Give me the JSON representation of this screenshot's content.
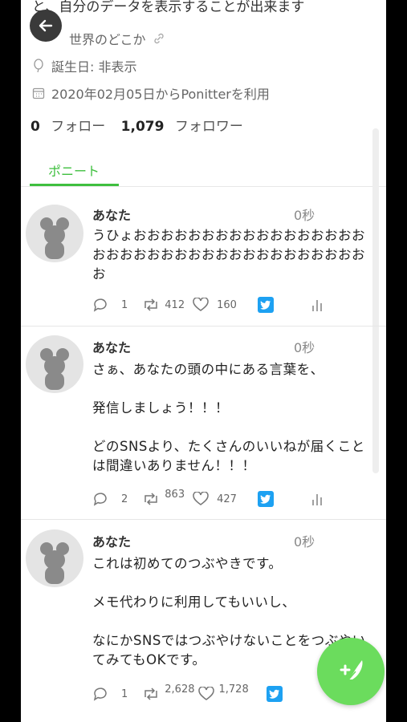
{
  "profile": {
    "bio_tail": "と、自分のデータを表示することが出来ます",
    "location": "世界のどこか",
    "birthday": "誕生日: 非表示",
    "joined": "2020年02月05日からPonitterを利用",
    "following_count": "0",
    "following_label": "フォロー",
    "followers_count": "1,079",
    "followers_label": "フォロワー"
  },
  "tabs": [
    {
      "label": "ポニート",
      "active": true
    }
  ],
  "posts": [
    {
      "name": "あなた",
      "time": "0秒",
      "text": "うひょおおおおおおおおおおおおおおおおおおおおおおおおおおおおおおおおおおおおおお",
      "replies": "1",
      "retweets": "412",
      "likes": "160"
    },
    {
      "name": "あなた",
      "time": "0秒",
      "text": "さぁ、あなたの頭の中にある言葉を、\n\n発信しましょう！！！\n\nどのSNSより、たくさんのいいねが届くことは間違いありません！！！",
      "replies": "2",
      "retweets": "863",
      "likes": "427"
    },
    {
      "name": "あなた",
      "time": "0秒",
      "text": "これは初めてのつぶやきです。\n\nメモ代わりに利用してもいいし、\n\nなにかSNSではつぶやけないことをつぶやいてみてもOKです。",
      "replies": "1",
      "retweets": "2,628",
      "likes": "1,728"
    }
  ],
  "icons": {
    "back": "arrow-left-icon",
    "location": "location-pin-icon",
    "link": "link-icon",
    "birthday": "balloon-icon",
    "calendar": "calendar-icon",
    "reply": "reply-icon",
    "retweet": "retweet-icon",
    "like": "heart-icon",
    "share": "twitter-icon",
    "stats": "bar-chart-icon",
    "compose": "compose-feather-icon"
  },
  "colors": {
    "accent": "#3fbf3f",
    "fab": "#6bdc5d",
    "twitter": "#1da1f2"
  }
}
